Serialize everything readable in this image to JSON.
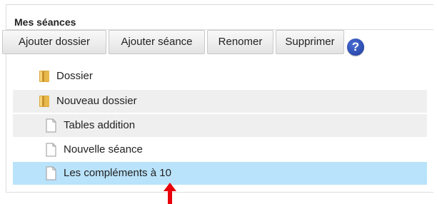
{
  "panel": {
    "title": "Mes séances"
  },
  "toolbar": {
    "buttons": [
      {
        "label": "Ajouter dossier"
      },
      {
        "label": "Ajouter séance"
      },
      {
        "label": "Renomer"
      },
      {
        "label": "Supprimer"
      }
    ],
    "help": {
      "label": "?",
      "icon": "help-icon"
    }
  },
  "tree": {
    "items": [
      {
        "label": "Dossier",
        "type": "folder",
        "icon": "folder-icon"
      },
      {
        "label": "Nouveau dossier",
        "type": "folder",
        "icon": "folder-icon"
      },
      {
        "label": "Tables addition",
        "type": "session",
        "icon": "document-icon"
      },
      {
        "label": "Nouvelle séance",
        "type": "session",
        "icon": "document-icon"
      },
      {
        "label": "Les compléments à 10",
        "type": "session",
        "icon": "document-icon",
        "selected": true
      }
    ]
  },
  "annotation": {
    "icon": "red-arrow-up-icon",
    "color": "#e8000b"
  },
  "colors": {
    "selected_row": "#b9e3fb",
    "shaded_row": "#efefef",
    "help_blue": "#1d3a9a"
  }
}
